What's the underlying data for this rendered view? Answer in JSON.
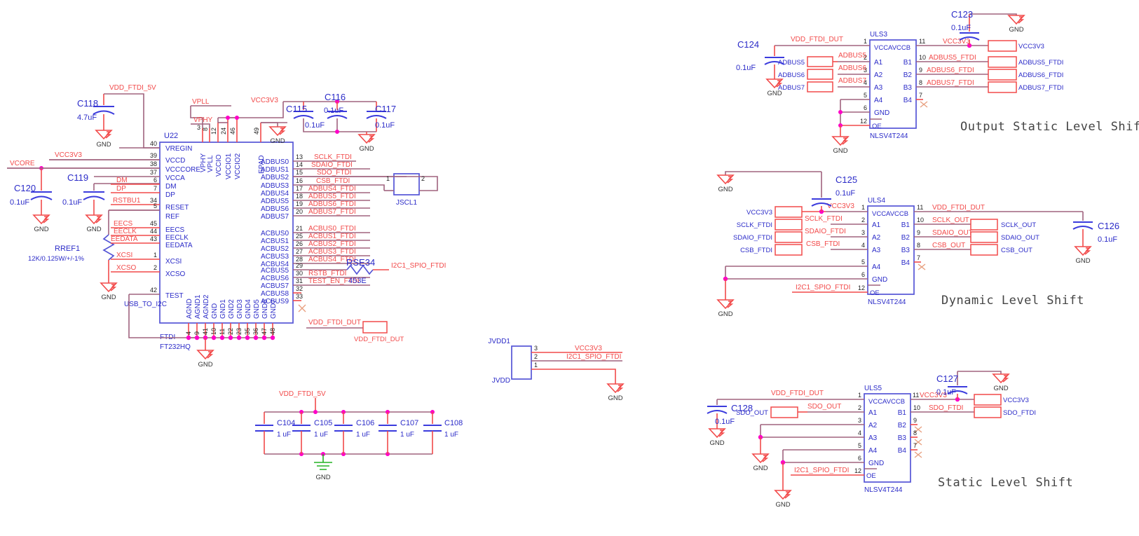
{
  "sheet": {
    "titles": {
      "output_static": "Output Static Level Shift",
      "dynamic": "Dynamic Level Shift",
      "static": "Static Level Shift"
    }
  },
  "u22": {
    "ref": "U22",
    "name": "FTDI",
    "part": "FT232HQ",
    "side_note": "USB_TO_I2C",
    "top_pins": [
      {
        "num": "3",
        "name": "VPHY"
      },
      {
        "num": "8",
        "name": "VPLL"
      },
      {
        "num": "12",
        "name": "VCCIO"
      },
      {
        "num": "24",
        "name": "VCCIO1"
      },
      {
        "num": "46",
        "name": "VCCIO2"
      },
      {
        "num": "49",
        "name": "EPAD"
      }
    ],
    "left_pins": [
      {
        "num": "40",
        "name": "VREGIN",
        "net": ""
      },
      {
        "num": "39",
        "name": "VCCD",
        "net": ""
      },
      {
        "num": "38",
        "name": "VCCCORE",
        "net": ""
      },
      {
        "num": "37",
        "name": "VCCA",
        "net": ""
      },
      {
        "num": "6",
        "name": "DM",
        "net": "DM"
      },
      {
        "num": "7",
        "name": "DP",
        "net": "DP"
      },
      {
        "num": "34",
        "name": "RESET",
        "net": "RSTBU1"
      },
      {
        "num": "5",
        "name": "REF",
        "net": ""
      },
      {
        "num": "45",
        "name": "EECS",
        "net": "EECS"
      },
      {
        "num": "44",
        "name": "EECLK",
        "net": "EECLK"
      },
      {
        "num": "43",
        "name": "EEDATA",
        "net": "EEDATA"
      },
      {
        "num": "1",
        "name": "XCSI",
        "net": "XCSI"
      },
      {
        "num": "2",
        "name": "XCSO",
        "net": "XCSO"
      },
      {
        "num": "42",
        "name": "TEST",
        "net": ""
      }
    ],
    "right_pins": [
      {
        "num": "13",
        "name": "ADBUS0",
        "net": "SCLK_FTDI"
      },
      {
        "num": "14",
        "name": "ADBUS1",
        "net": "SDAIO_FTDI"
      },
      {
        "num": "15",
        "name": "ADBUS2",
        "net": "SDO_FTDI"
      },
      {
        "num": "16",
        "name": "ADBUS3",
        "net": "CSB_FTDI"
      },
      {
        "num": "17",
        "name": "ADBUS4",
        "net": "ADBUS4_FTDI"
      },
      {
        "num": "18",
        "name": "ADBUS5",
        "net": "ADBUS5_FTDI"
      },
      {
        "num": "19",
        "name": "ADBUS6",
        "net": "ADBUS6_FTDI"
      },
      {
        "num": "20",
        "name": "ADBUS7",
        "net": "ADBUS7_FTDI"
      },
      {
        "num": "21",
        "name": "ACBUS0",
        "net": "ACBUS0_FTDI"
      },
      {
        "num": "25",
        "name": "ACBUS1",
        "net": "ACBUS1_FTDI"
      },
      {
        "num": "26",
        "name": "ACBUS2",
        "net": "ACBUS2_FTDI"
      },
      {
        "num": "27",
        "name": "ACBUS3",
        "net": "ACBUS3_FTDI"
      },
      {
        "num": "28",
        "name": "ACBUS4",
        "net": "ACBUS4_FTDI"
      },
      {
        "num": "29",
        "name": "ACBUS5",
        "net": ""
      },
      {
        "num": "30",
        "name": "ACBUS6",
        "net": "RSTB_FTDI"
      },
      {
        "num": "31",
        "name": "ACBUS7",
        "net": "TEST_EN_FTDI"
      },
      {
        "num": "32",
        "name": "ACBUS8",
        "net": ""
      },
      {
        "num": "33",
        "name": "ACBUS9",
        "net": ""
      }
    ],
    "bottom_pins": [
      {
        "num": "4",
        "name": "AGND"
      },
      {
        "num": "9",
        "name": "AGND1"
      },
      {
        "num": "41",
        "name": "AGND2"
      },
      {
        "num": "10",
        "name": "GND"
      },
      {
        "num": "11",
        "name": "GND1"
      },
      {
        "num": "22",
        "name": "GND2"
      },
      {
        "num": "23",
        "name": "GND3"
      },
      {
        "num": "35",
        "name": "GND4"
      },
      {
        "num": "36",
        "name": "GND5"
      },
      {
        "num": "47",
        "name": "GND6"
      },
      {
        "num": "48",
        "name": "GND7"
      }
    ]
  },
  "nets": {
    "vdd_ftdi_5v": "VDD_FTDI_5V",
    "vcc3v3": "VCC3V3",
    "vcore": "VCORE",
    "vpll": "VPLL",
    "vphy": "VPHY",
    "vdd_ftdi_dut": "VDD_FTDI_DUT",
    "i2c1_spio_ftdi": "I2C1_SPIO_FTDI",
    "gnd": "GND"
  },
  "caps": {
    "c118": {
      "ref": "C118",
      "val": "4.7uF"
    },
    "c115": {
      "ref": "C115",
      "val": "0.1uF"
    },
    "c116": {
      "ref": "C116",
      "val": "0.1uF"
    },
    "c117": {
      "ref": "C117",
      "val": "0.1uF"
    },
    "c119": {
      "ref": "C119",
      "val": "0.1uF"
    },
    "c120": {
      "ref": "C120",
      "val": "0.1uF"
    },
    "c123": {
      "ref": "C123",
      "val": "0.1uF"
    },
    "c124": {
      "ref": "C124",
      "val": "0.1uF"
    },
    "c125": {
      "ref": "C125",
      "val": "0.1uF"
    },
    "c126": {
      "ref": "C126",
      "val": "0.1uF"
    },
    "c127": {
      "ref": "C127",
      "val": "0.1uF"
    },
    "c128": {
      "ref": "C128",
      "val": "0.1uF"
    },
    "c104": {
      "ref": "C104",
      "val": "1 uF"
    },
    "c105": {
      "ref": "C105",
      "val": "1 uF"
    },
    "c106": {
      "ref": "C106",
      "val": "1 uF"
    },
    "c107": {
      "ref": "C107",
      "val": "1 uF"
    },
    "c108": {
      "ref": "C108",
      "val": "1 uF"
    }
  },
  "resistors": {
    "rref1": {
      "ref": "RREF1",
      "val": "12K/0.125W/+/-1%"
    },
    "rse34": {
      "ref": "RSE34",
      "val": "453E"
    }
  },
  "jscl1": {
    "ref": "JSCL1",
    "pin1": "1",
    "pin2": "2"
  },
  "jvdd1": {
    "ref": "JVDD1",
    "name": "JVDD",
    "pins": [
      {
        "num": "3",
        "net": "VCC3V3"
      },
      {
        "num": "2",
        "net": "I2C1_SPIO_FTDI"
      },
      {
        "num": "1",
        "net": ""
      }
    ]
  },
  "uls3": {
    "ref": "ULS3",
    "part": "NLSV4T244",
    "left": [
      {
        "num": "1",
        "name": "VCCA",
        "net": "VDD_FTDI_DUT",
        "port": ""
      },
      {
        "num": "2",
        "name": "A1",
        "net": "ADBUS5",
        "port": "ADBUS5"
      },
      {
        "num": "3",
        "name": "A2",
        "net": "ADBUS6",
        "port": "ADBUS6"
      },
      {
        "num": "4",
        "name": "A3",
        "net": "ADBUS7",
        "port": "ADBUS7"
      },
      {
        "num": "5",
        "name": "A4",
        "net": "",
        "port": ""
      },
      {
        "num": "6",
        "name": "GND",
        "net": "",
        "port": ""
      },
      {
        "num": "12",
        "name": "OE",
        "net": "",
        "port": ""
      }
    ],
    "right": [
      {
        "num": "11",
        "name": "VCCB",
        "net": "VCC3V3",
        "port": "VCC3V3"
      },
      {
        "num": "10",
        "name": "B1",
        "net": "ADBUS5_FTDI",
        "port": "ADBUS5_FTDI"
      },
      {
        "num": "9",
        "name": "B2",
        "net": "ADBUS6_FTDI",
        "port": "ADBUS6_FTDI"
      },
      {
        "num": "8",
        "name": "B3",
        "net": "ADBUS7_FTDI",
        "port": "ADBUS7_FTDI"
      },
      {
        "num": "7",
        "name": "B4",
        "net": "",
        "port": ""
      }
    ]
  },
  "uls4": {
    "ref": "ULS4",
    "part": "NLSV4T244",
    "left": [
      {
        "num": "1",
        "name": "VCCA",
        "net": "VCC3V3",
        "port": "VCC3V3"
      },
      {
        "num": "2",
        "name": "A1",
        "net": "SCLK_FTDI",
        "port": "SCLK_FTDI"
      },
      {
        "num": "3",
        "name": "A2",
        "net": "SDAIO_FTDI",
        "port": "SDAIO_FTDI"
      },
      {
        "num": "4",
        "name": "A3",
        "net": "CSB_FTDI",
        "port": "CSB_FTDI"
      },
      {
        "num": "5",
        "name": "A4",
        "net": "",
        "port": ""
      },
      {
        "num": "6",
        "name": "GND",
        "net": "",
        "port": ""
      },
      {
        "num": "12",
        "name": "OE",
        "net": "I2C1_SPIO_FTDI",
        "port": ""
      }
    ],
    "right": [
      {
        "num": "11",
        "name": "VCCB",
        "net": "VDD_FTDI_DUT",
        "port": ""
      },
      {
        "num": "10",
        "name": "B1",
        "net": "SCLK_OUT",
        "port": "SCLK_OUT"
      },
      {
        "num": "9",
        "name": "B2",
        "net": "SDAIO_OUT",
        "port": "SDAIO_OUT"
      },
      {
        "num": "8",
        "name": "B3",
        "net": "CSB_OUT",
        "port": "CSB_OUT"
      },
      {
        "num": "7",
        "name": "B4",
        "net": "",
        "port": ""
      }
    ]
  },
  "uls5": {
    "ref": "ULS5",
    "part": "NLSV4T244",
    "left": [
      {
        "num": "1",
        "name": "VCCA",
        "net": "VDD_FTDI_DUT",
        "port": ""
      },
      {
        "num": "2",
        "name": "A1",
        "net": "SDO_OUT",
        "port": "SDO_OUT"
      },
      {
        "num": "3",
        "name": "A2",
        "net": "",
        "port": ""
      },
      {
        "num": "4",
        "name": "A3",
        "net": "",
        "port": ""
      },
      {
        "num": "5",
        "name": "A4",
        "net": "",
        "port": ""
      },
      {
        "num": "6",
        "name": "GND",
        "net": "",
        "port": ""
      },
      {
        "num": "12",
        "name": "OE",
        "net": "I2C1_SPIO_FTDI",
        "port": ""
      }
    ],
    "right": [
      {
        "num": "11",
        "name": "VCCB",
        "net": "VCC3V3",
        "port": "VCC3V3"
      },
      {
        "num": "10",
        "name": "B1",
        "net": "SDO_FTDI",
        "port": "SDO_FTDI"
      },
      {
        "num": "9",
        "name": "B2",
        "net": "",
        "port": ""
      },
      {
        "num": "8",
        "name": "B3",
        "net": "",
        "port": ""
      },
      {
        "num": "7",
        "name": "B4",
        "net": "",
        "port": ""
      }
    ]
  },
  "vccavccb_label": "VCCAVCCB"
}
